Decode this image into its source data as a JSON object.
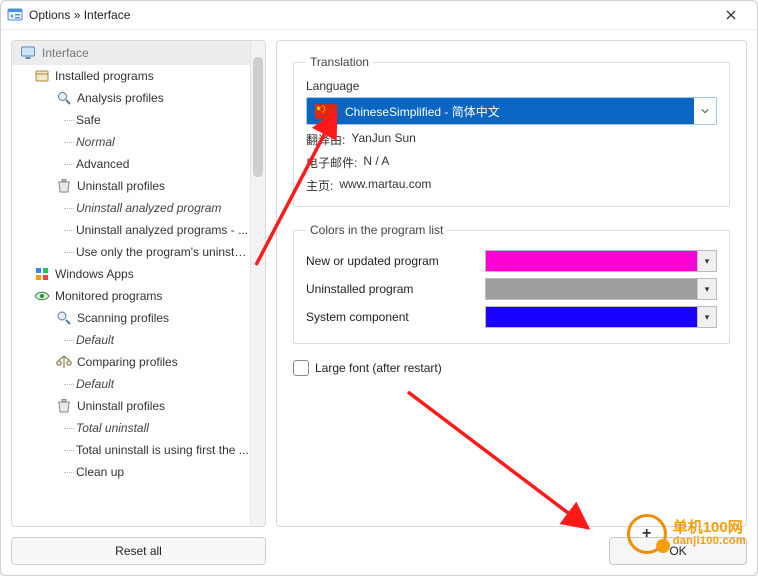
{
  "window": {
    "title": "Options » Interface"
  },
  "tree": {
    "top": "Interface",
    "installed_programs": "Installed programs",
    "analysis_profiles": "Analysis profiles",
    "safe": "Safe",
    "normal": "Normal",
    "advanced": "Advanced",
    "uninstall_profiles": "Uninstall profiles",
    "uninstall_analyzed_program": "Uninstall analyzed program",
    "uninstall_analyzed_programs": "Uninstall analyzed programs - ...",
    "use_only_programs_uninsta": "Use only the program's uninsta...",
    "windows_apps": "Windows Apps",
    "monitored_programs": "Monitored programs",
    "scanning_profiles": "Scanning profiles",
    "default1": "Default",
    "comparing_profiles": "Comparing profiles",
    "default2": "Default",
    "uninstall_profiles2": "Uninstall profiles",
    "total_uninstall": "Total uninstall",
    "total_uninstall_first": "Total uninstall is using first the ...",
    "clean_up": "Clean up"
  },
  "translation": {
    "legend": "Translation",
    "language_label": "Language",
    "language_value": "ChineseSimplified - 简体中文",
    "rows": {
      "translator_key": "翻译由:",
      "translator_val": "YanJun Sun",
      "email_key": "电子邮件:",
      "email_val": "N / A",
      "home_key": "主页:",
      "home_val": "www.martau.com"
    }
  },
  "colors": {
    "legend": "Colors in the program list",
    "rows": [
      {
        "label": "New or updated program",
        "color": "#ff00d4"
      },
      {
        "label": "Uninstalled program",
        "color": "#9e9e9e"
      },
      {
        "label": "System component",
        "color": "#1a00ff"
      }
    ]
  },
  "large_font_label": "Large font (after restart)",
  "footer": {
    "reset": "Reset all",
    "ok": "OK"
  },
  "watermark": {
    "zh": "单机100网",
    "url": "danji100.com"
  }
}
